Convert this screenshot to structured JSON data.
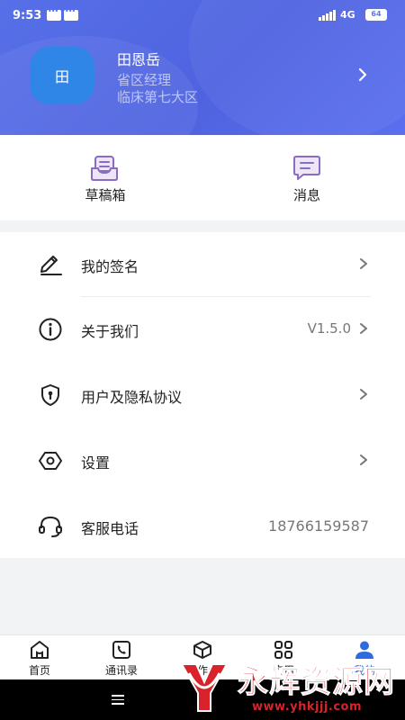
{
  "status_bar": {
    "time": "9:53",
    "network": "4G",
    "battery": "64"
  },
  "profile": {
    "avatar_text": "田",
    "name": "田恩岳",
    "role": "省区经理",
    "region": "临床第七大区"
  },
  "quick_actions": [
    {
      "label": "草稿箱",
      "icon": "drafts-inbox-icon"
    },
    {
      "label": "消息",
      "icon": "message-icon"
    }
  ],
  "menu": [
    {
      "label": "我的签名",
      "value": "",
      "icon": "signature-pen-icon"
    },
    {
      "label": "关于我们",
      "value": "V1.5.0",
      "icon": "info-icon"
    },
    {
      "label": "用户及隐私协议",
      "value": "",
      "icon": "privacy-shield-icon"
    },
    {
      "label": "设置",
      "value": "",
      "icon": "settings-hexagon-icon"
    },
    {
      "label": "客服电话",
      "value": "18766159587",
      "icon": "headset-icon"
    }
  ],
  "tabs": [
    {
      "label": "首页",
      "icon": "home-icon"
    },
    {
      "label": "通讯录",
      "icon": "contacts-icon"
    },
    {
      "label": "工作台",
      "icon": "workbench-box-icon"
    },
    {
      "label": "应用",
      "icon": "apps-grid-icon"
    },
    {
      "label": "我的",
      "icon": "user-icon",
      "active": true
    }
  ],
  "watermark": {
    "text": "永辉资源网",
    "url": "www.yhkjjj.com"
  },
  "colors": {
    "header": "#5670e8",
    "accent": "#2f6be0",
    "avatar": "#2f86e6",
    "icon_purple": "#8a6cc4",
    "watermark": "#d8232a"
  }
}
